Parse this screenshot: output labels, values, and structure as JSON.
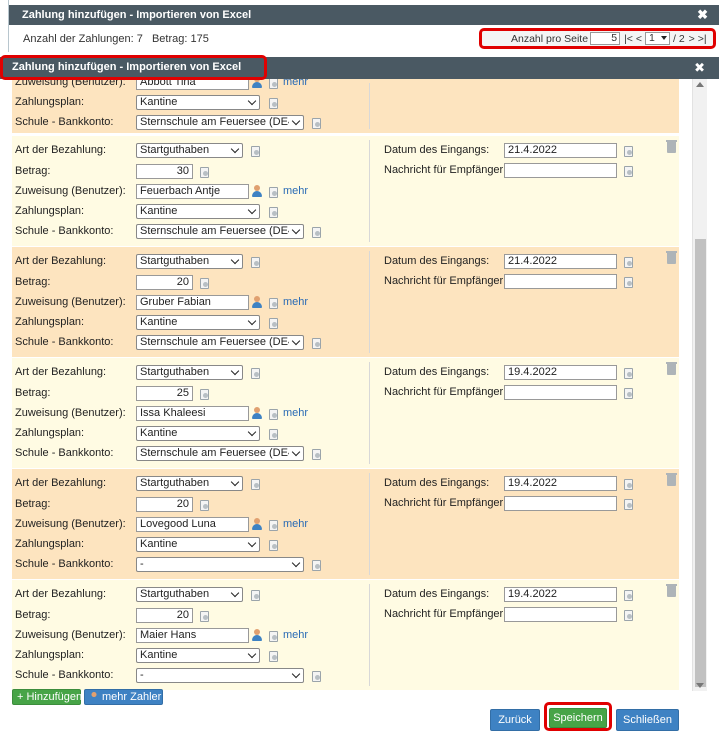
{
  "back_dialog": {
    "title": "Zahlung hinzufügen - Importieren von Excel",
    "count_label": "Anzahl der Zahlungen: 7",
    "amount_label": "Betrag: 175",
    "per_page_label": "Anzahl pro Seite",
    "per_page_value": "5",
    "first_prev": "|< <",
    "page_value": "1",
    "page_total": "/ 2",
    "next_last": "> >|",
    "close_glyph": "✖"
  },
  "dialog": {
    "title": "Zahlung hinzufügen - Importieren von Excel",
    "close_glyph": "✖"
  },
  "labels": {
    "payment_type": "Art der Bezahlung:",
    "amount": "Betrag:",
    "assignment": "Zuweisung (Benutzer):",
    "payment_plan": "Zahlungsplan:",
    "school_account": "Schule - Bankkonto:",
    "received_date": "Datum des Eingangs:",
    "message": "Nachricht für Empfänger:",
    "mehr": "mehr"
  },
  "partial_record": {
    "user": "Abbott Tina",
    "plan": "Kantine",
    "account": "Sternschule am Feuersee (DE4"
  },
  "records": [
    {
      "type": "Startguthaben",
      "amount": "30",
      "user": "Feuerbach Antje",
      "plan": "Kantine",
      "account": "Sternschule am Feuersee (DE4",
      "date": "21.4.2022",
      "message": ""
    },
    {
      "type": "Startguthaben",
      "amount": "20",
      "user": "Gruber Fabian",
      "plan": "Kantine",
      "account": "Sternschule am Feuersee (DE4",
      "date": "21.4.2022",
      "message": ""
    },
    {
      "type": "Startguthaben",
      "amount": "25",
      "user": "Issa Khaleesi",
      "plan": "Kantine",
      "account": "Sternschule am Feuersee (DE4",
      "date": "19.4.2022",
      "message": ""
    },
    {
      "type": "Startguthaben",
      "amount": "20",
      "user": "Lovegood Luna",
      "plan": "Kantine",
      "account": "-",
      "date": "19.4.2022",
      "message": ""
    },
    {
      "type": "Startguthaben",
      "amount": "20",
      "user": "Maier Hans",
      "plan": "Kantine",
      "account": "-",
      "date": "19.4.2022",
      "message": ""
    }
  ],
  "buttons": {
    "add": "+ Hinzufügen",
    "more_payers": "mehr Zahler",
    "back": "Zurück",
    "save": "Speichern",
    "close": "Schließen"
  },
  "colors": {
    "header": "#4a5963",
    "highlight": "#e00000",
    "record_orange": "#fde4bf",
    "record_pale": "#fffbe3",
    "green": "#47a447",
    "blue": "#3e82c3"
  }
}
